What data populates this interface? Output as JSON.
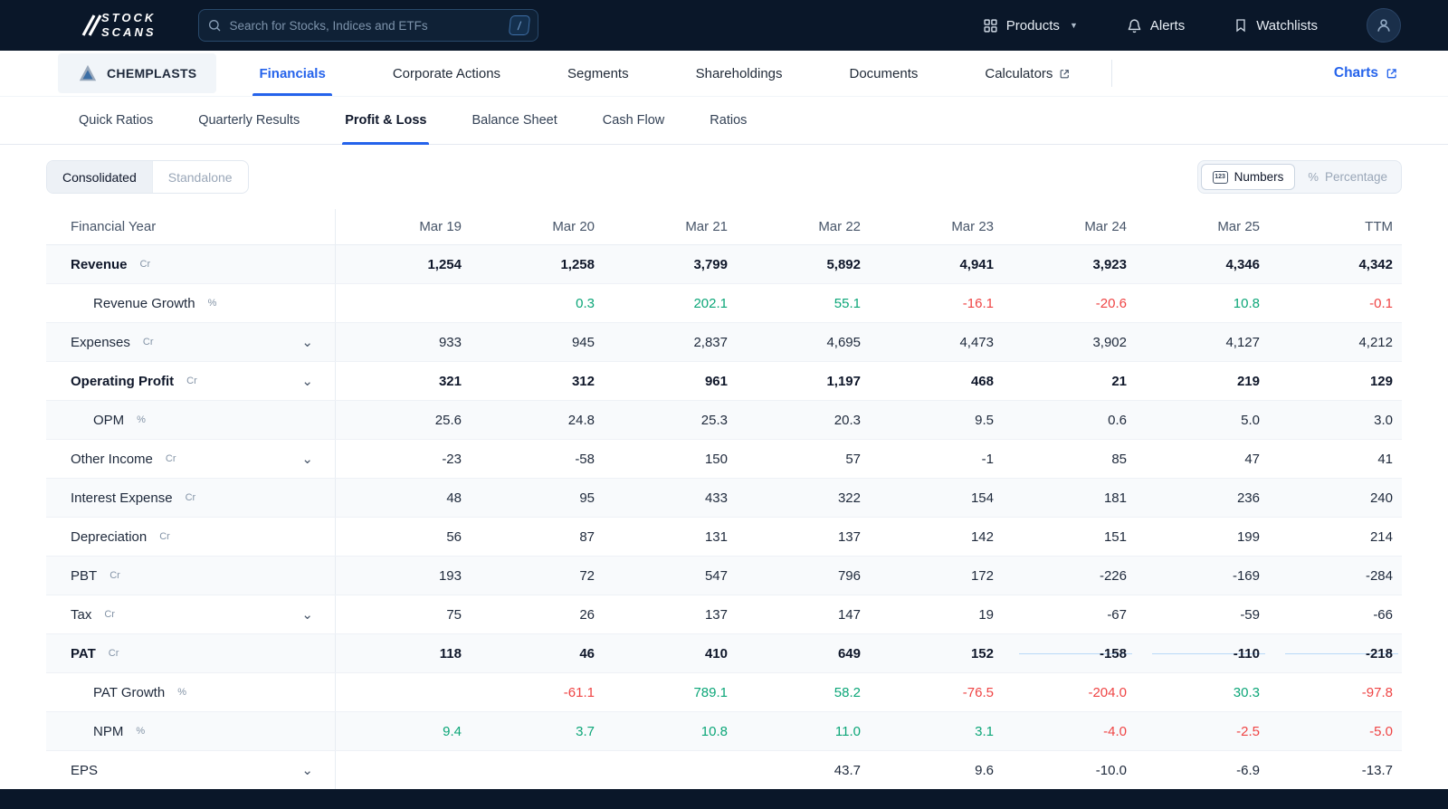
{
  "colors": {
    "navbar": "#0a1729",
    "accent": "#2563eb",
    "positive": "#0ca678",
    "negative": "#ef4444",
    "highlight": "#b9d9f8"
  },
  "topbar": {
    "brand": {
      "line1": "STOCK",
      "line2": "SCANS"
    },
    "search": {
      "placeholder": "Search for Stocks, Indices and ETFs",
      "shortcut": "/"
    },
    "nav": [
      {
        "label": "Products"
      },
      {
        "label": "Alerts"
      },
      {
        "label": "Watchlists"
      }
    ]
  },
  "company_bar": {
    "company": "CHEMPLASTS",
    "tabs": [
      {
        "label": "Financials",
        "active": true
      },
      {
        "label": "Corporate Actions"
      },
      {
        "label": "Segments"
      },
      {
        "label": "Shareholdings"
      },
      {
        "label": "Documents"
      },
      {
        "label": "Calculators",
        "external": true
      }
    ],
    "charts_link": "Charts"
  },
  "subtabs": [
    {
      "label": "Quick Ratios"
    },
    {
      "label": "Quarterly Results"
    },
    {
      "label": "Profit & Loss",
      "active": true
    },
    {
      "label": "Balance Sheet"
    },
    {
      "label": "Cash Flow"
    },
    {
      "label": "Ratios"
    }
  ],
  "controls": {
    "consolidation": {
      "options": [
        "Consolidated",
        "Standalone"
      ],
      "selected": "Consolidated"
    },
    "display_mode": {
      "options": [
        "Numbers",
        "Percentage"
      ],
      "selected": "Numbers"
    }
  },
  "table": {
    "first_col_header": "Financial Year",
    "columns": [
      "Mar 19",
      "Mar 20",
      "Mar 21",
      "Mar 22",
      "Mar 23",
      "Mar 24",
      "Mar 25",
      "TTM"
    ],
    "rows": [
      {
        "label": "Revenue",
        "unit": "Cr",
        "bold": true,
        "values": [
          "1,254",
          "1,258",
          "3,799",
          "5,892",
          "4,941",
          "3,923",
          "4,346",
          "4,342"
        ]
      },
      {
        "label": "Revenue Growth",
        "unit": "%",
        "indent": true,
        "colored": true,
        "values": [
          "",
          "0.3",
          "202.1",
          "55.1",
          "-16.1",
          "-20.6",
          "10.8",
          "-0.1"
        ]
      },
      {
        "label": "Expenses",
        "unit": "Cr",
        "expandable": true,
        "values": [
          "933",
          "945",
          "2,837",
          "4,695",
          "4,473",
          "3,902",
          "4,127",
          "4,212"
        ]
      },
      {
        "label": "Operating Profit",
        "unit": "Cr",
        "bold": true,
        "expandable": true,
        "values": [
          "321",
          "312",
          "961",
          "1,197",
          "468",
          "21",
          "219",
          "129"
        ]
      },
      {
        "label": "OPM",
        "unit": "%",
        "indent": true,
        "values": [
          "25.6",
          "24.8",
          "25.3",
          "20.3",
          "9.5",
          "0.6",
          "5.0",
          "3.0"
        ]
      },
      {
        "label": "Other Income",
        "unit": "Cr",
        "expandable": true,
        "values": [
          "-23",
          "-58",
          "150",
          "57",
          "-1",
          "85",
          "47",
          "41"
        ]
      },
      {
        "label": "Interest Expense",
        "unit": "Cr",
        "values": [
          "48",
          "95",
          "433",
          "322",
          "154",
          "181",
          "236",
          "240"
        ]
      },
      {
        "label": "Depreciation",
        "unit": "Cr",
        "values": [
          "56",
          "87",
          "131",
          "137",
          "142",
          "151",
          "199",
          "214"
        ]
      },
      {
        "label": "PBT",
        "unit": "Cr",
        "values": [
          "193",
          "72",
          "547",
          "796",
          "172",
          "-226",
          "-169",
          "-284"
        ]
      },
      {
        "label": "Tax",
        "unit": "Cr",
        "expandable": true,
        "values": [
          "75",
          "26",
          "137",
          "147",
          "19",
          "-67",
          "-59",
          "-66"
        ]
      },
      {
        "label": "PAT",
        "unit": "Cr",
        "bold": true,
        "values": [
          "118",
          "46",
          "410",
          "649",
          "152",
          "-158",
          "-110",
          "-218"
        ],
        "highlights": {
          "4": "partial",
          "5": "full",
          "6": "full",
          "7": "full"
        }
      },
      {
        "label": "PAT Growth",
        "unit": "%",
        "indent": true,
        "colored": true,
        "values": [
          "",
          "-61.1",
          "789.1",
          "58.2",
          "-76.5",
          "-204.0",
          "30.3",
          "-97.8"
        ]
      },
      {
        "label": "NPM",
        "unit": "%",
        "indent": true,
        "colored": true,
        "values": [
          "9.4",
          "3.7",
          "10.8",
          "11.0",
          "3.1",
          "-4.0",
          "-2.5",
          "-5.0"
        ]
      },
      {
        "label": "EPS",
        "expandable": true,
        "values": [
          "",
          "",
          "",
          "43.7",
          "9.6",
          "-10.0",
          "-6.9",
          "-13.7"
        ]
      }
    ]
  }
}
